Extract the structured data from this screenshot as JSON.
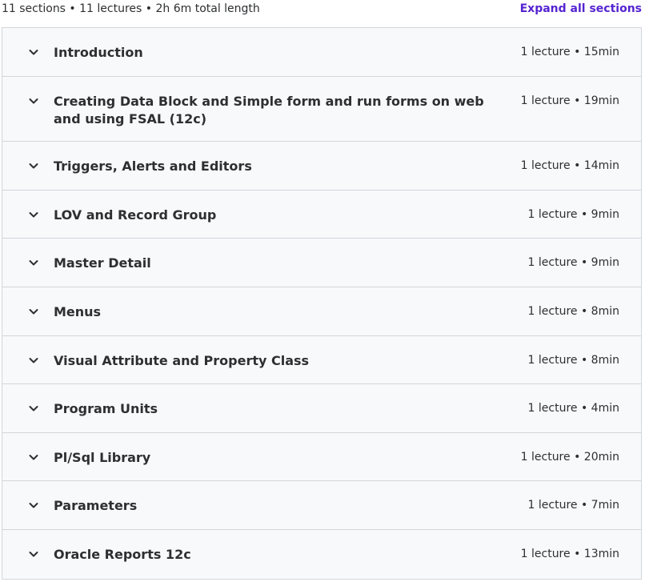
{
  "header": {
    "summary": "11 sections • 11 lectures • 2h 6m total length",
    "expand_label": "Expand all sections"
  },
  "colors": {
    "accent": "#5624d0",
    "section_bg": "#f7f9fa",
    "border": "#d1d7dc",
    "text": "#2d2f31"
  },
  "sections": [
    {
      "title": "Introduction",
      "meta": "1 lecture • 15min"
    },
    {
      "title": "Creating Data Block and Simple form and run forms on web and using FSAL (12c)",
      "meta": "1 lecture • 19min"
    },
    {
      "title": "Triggers, Alerts and Editors",
      "meta": "1 lecture • 14min"
    },
    {
      "title": "LOV and Record Group",
      "meta": "1 lecture • 9min"
    },
    {
      "title": "Master Detail",
      "meta": "1 lecture • 9min"
    },
    {
      "title": "Menus",
      "meta": "1 lecture • 8min"
    },
    {
      "title": "Visual Attribute and Property Class",
      "meta": "1 lecture • 8min"
    },
    {
      "title": "Program Units",
      "meta": "1 lecture • 4min"
    },
    {
      "title": "Pl/Sql Library",
      "meta": "1 lecture • 20min"
    },
    {
      "title": "Parameters",
      "meta": "1 lecture • 7min"
    },
    {
      "title": "Oracle Reports 12c",
      "meta": "1 lecture • 13min"
    }
  ]
}
